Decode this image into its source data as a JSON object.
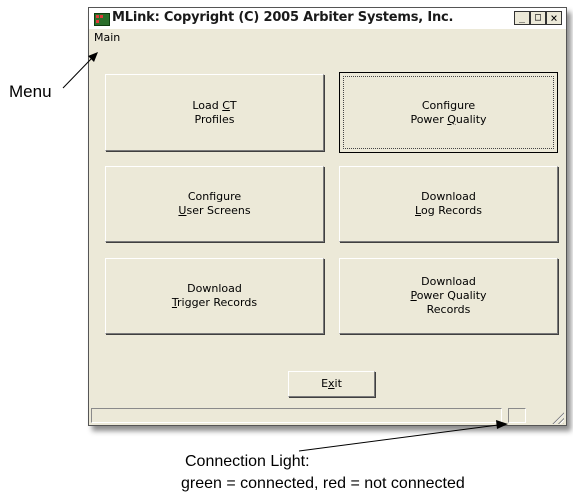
{
  "window": {
    "title": "MLink: Copyright (C) 2005 Arbiter Systems, Inc.",
    "controls": {
      "minimize": "_",
      "maximize": "□",
      "close": "×"
    }
  },
  "menubar": {
    "items": [
      {
        "label": "Main"
      }
    ]
  },
  "buttons": [
    {
      "line1": "Load ",
      "line1_key": "C",
      "line1_rest": "T",
      "line2": "Profiles"
    },
    {
      "line1": "Configure",
      "line2_pre": "Power ",
      "line2_key": "Q",
      "line2_rest": "uality"
    },
    {
      "line1": "Configure",
      "line2_key": "U",
      "line2_rest": "ser Screens"
    },
    {
      "line1": "Download",
      "line2_key": "L",
      "line2_rest": "og Records"
    },
    {
      "line1": "Download",
      "line2_key": "T",
      "line2_rest": "rigger Records"
    },
    {
      "line1": "Download",
      "line2_key": "P",
      "line2_rest": "ower Quality",
      "line3": "Records"
    }
  ],
  "exit_button": {
    "pre": "E",
    "key": "x",
    "rest": "it"
  },
  "annotations": {
    "menu": "Menu",
    "connection_title": "Connection Light:",
    "connection_desc": "green = connected, red = not connected"
  },
  "colors": {
    "window_bg": "#ece9d8",
    "app_icon": "#2a6e2a"
  }
}
